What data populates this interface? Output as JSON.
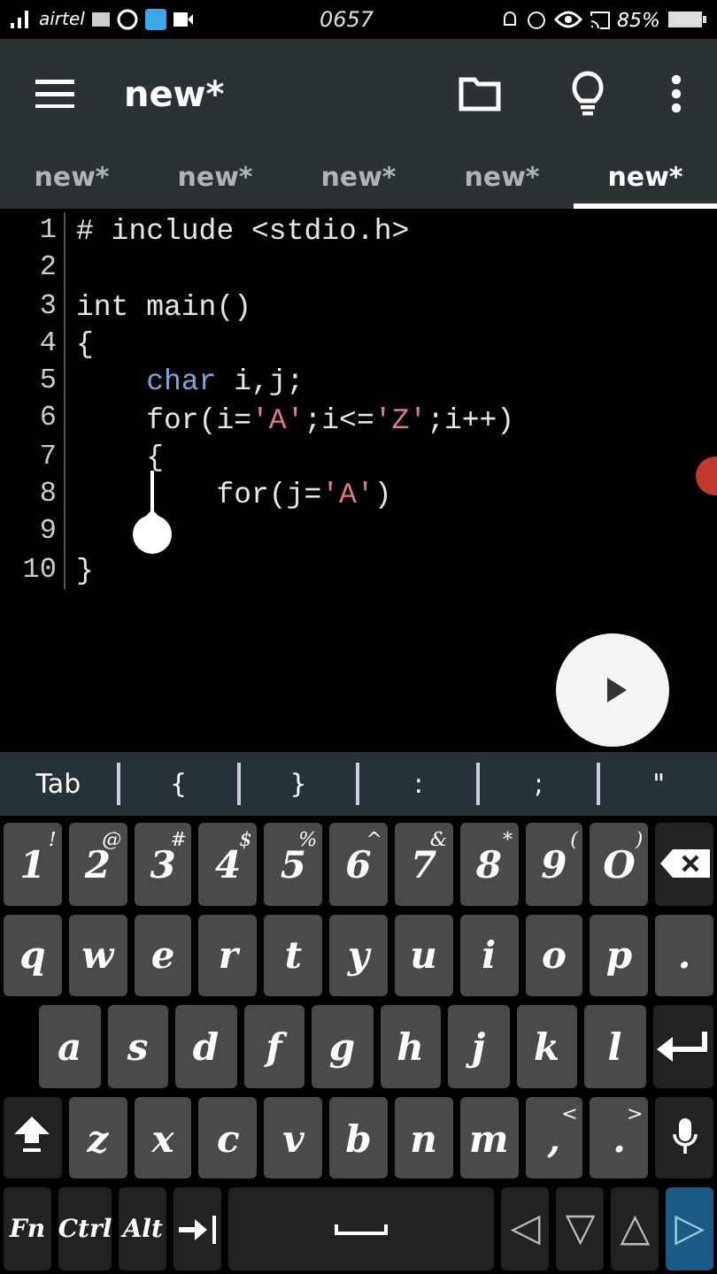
{
  "status_bar": {
    "carrier": "airtel",
    "time": "0657",
    "battery": "85%"
  },
  "app_bar": {
    "title": "new*"
  },
  "tabs": [
    {
      "label": "new*",
      "selected": false
    },
    {
      "label": "new*",
      "selected": false
    },
    {
      "label": "new*",
      "selected": false
    },
    {
      "label": "new*",
      "selected": false
    },
    {
      "label": "new*",
      "selected": true
    }
  ],
  "editor": {
    "lines": [
      {
        "number": "1",
        "tokens": [
          {
            "text": "# include <stdio.h>",
            "kind": "plain"
          }
        ]
      },
      {
        "number": "2"
      },
      {
        "number": "3",
        "tokens": [
          {
            "text": "int main()",
            "kind": "plain"
          }
        ]
      },
      {
        "number": "4",
        "tokens": [
          {
            "text": "{",
            "kind": "plain"
          }
        ],
        "children": [
          {
            "number": "5",
            "tokens": [
              {
                "text": "char",
                "kind": "type"
              },
              {
                "text": " i,j;",
                "kind": "plain"
              }
            ]
          },
          {
            "number": "6",
            "tokens": [
              {
                "text": "for(i=",
                "kind": "plain"
              },
              {
                "text": "'A'",
                "kind": "string"
              },
              {
                "text": ";i<=",
                "kind": "plain"
              },
              {
                "text": "'Z'",
                "kind": "string"
              },
              {
                "text": ";i++)",
                "kind": "plain"
              }
            ]
          },
          {
            "number": "7",
            "tokens": [
              {
                "text": "{",
                "kind": "plain"
              }
            ],
            "children": [
              {
                "number": "8",
                "tokens": [
                  {
                    "text": "for(j=",
                    "kind": "plain"
                  },
                  {
                    "text": "'A'",
                    "kind": "string"
                  },
                  {
                    "text": ")",
                    "kind": "plain"
                  }
                ]
              }
            ]
          }
        ]
      },
      {
        "number": "9"
      },
      {
        "number": "10",
        "tokens": [
          {
            "text": "}",
            "kind": "plain"
          }
        ]
      }
    ]
  },
  "extra_keys": [
    "Tab",
    "{",
    "}",
    ":",
    ";",
    "\""
  ],
  "keyboard": {
    "number_row": [
      {
        "label": "1",
        "alt": "!",
        "kind": "char"
      },
      {
        "label": "2",
        "alt": "@",
        "kind": "char"
      },
      {
        "label": "3",
        "alt": "#",
        "kind": "char"
      },
      {
        "label": "4",
        "alt": "$",
        "kind": "char"
      },
      {
        "label": "5",
        "alt": "%",
        "kind": "char"
      },
      {
        "label": "6",
        "alt": "^",
        "kind": "char"
      },
      {
        "label": "7",
        "alt": "&",
        "kind": "char"
      },
      {
        "label": "8",
        "alt": "*",
        "kind": "char"
      },
      {
        "label": "9",
        "alt": "(",
        "kind": "char"
      },
      {
        "label": "O",
        "alt": ")",
        "kind": "char"
      },
      {
        "kind": "backspace"
      }
    ],
    "top_row": [
      {
        "label": "q",
        "kind": "char"
      },
      {
        "label": "w",
        "kind": "char"
      },
      {
        "label": "e",
        "kind": "char"
      },
      {
        "label": "r",
        "kind": "char"
      },
      {
        "label": "t",
        "kind": "char"
      },
      {
        "label": "y",
        "kind": "char"
      },
      {
        "label": "u",
        "kind": "char"
      },
      {
        "label": "i",
        "kind": "char"
      },
      {
        "label": "o",
        "kind": "char"
      },
      {
        "label": "p",
        "kind": "char"
      },
      {
        "label": ".",
        "kind": "char"
      }
    ],
    "home_row": [
      {
        "label": "a",
        "kind": "char"
      },
      {
        "label": "s",
        "kind": "char"
      },
      {
        "label": "d",
        "kind": "char"
      },
      {
        "label": "f",
        "kind": "char"
      },
      {
        "label": "g",
        "kind": "char"
      },
      {
        "label": "h",
        "kind": "char"
      },
      {
        "label": "j",
        "kind": "char"
      },
      {
        "label": "k",
        "kind": "char"
      },
      {
        "label": "l",
        "kind": "char"
      },
      {
        "kind": "enter"
      }
    ],
    "bottom_row": [
      {
        "kind": "shift"
      },
      {
        "label": "z",
        "kind": "char"
      },
      {
        "label": "x",
        "kind": "char"
      },
      {
        "label": "c",
        "kind": "char"
      },
      {
        "label": "v",
        "kind": "char"
      },
      {
        "label": "b",
        "kind": "char"
      },
      {
        "label": "n",
        "kind": "char"
      },
      {
        "label": "m",
        "kind": "char"
      },
      {
        "label": ",",
        "alt": "<",
        "kind": "char"
      },
      {
        "label": ".",
        "alt": ">",
        "kind": "char"
      },
      {
        "kind": "mic"
      }
    ],
    "function_row": [
      {
        "label": "Fn",
        "kind": "mod"
      },
      {
        "label": "Ctrl",
        "kind": "mod"
      },
      {
        "label": "Alt",
        "kind": "mod"
      },
      {
        "kind": "tab"
      },
      {
        "kind": "space"
      },
      {
        "label": "◁",
        "kind": "arrow",
        "selected": false
      },
      {
        "label": "▽",
        "kind": "arrow",
        "selected": false
      },
      {
        "label": "△",
        "kind": "arrow",
        "selected": false
      },
      {
        "label": "▷",
        "kind": "arrow",
        "selected": true
      }
    ]
  }
}
